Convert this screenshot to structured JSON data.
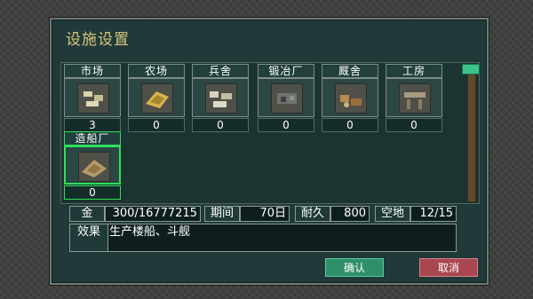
{
  "title": "设施设置",
  "facilities": [
    {
      "label": "市场",
      "count": "3",
      "icon": "market-icon",
      "color": "#cfc6a6"
    },
    {
      "label": "农场",
      "count": "0",
      "icon": "farm-icon",
      "color": "#d4b04a"
    },
    {
      "label": "兵舍",
      "count": "0",
      "icon": "barracks-icon",
      "color": "#c9c4b2"
    },
    {
      "label": "锻冶厂",
      "count": "0",
      "icon": "forge-icon",
      "color": "#6b6f6c"
    },
    {
      "label": "厩舍",
      "count": "0",
      "icon": "stable-icon",
      "color": "#b08552"
    },
    {
      "label": "工房",
      "count": "0",
      "icon": "workshop-icon",
      "color": "#a99b82"
    },
    {
      "label": "造船厂",
      "count": "0",
      "icon": "shipyard-icon",
      "color": "#b59a6a",
      "selected": true
    }
  ],
  "info": {
    "gold_label": "金",
    "gold_value": "300/16777215",
    "period_label": "期间",
    "period_value": "70日",
    "durability_label": "耐久",
    "durability_value": "800",
    "space_label": "空地",
    "space_value": "12/15"
  },
  "effect": {
    "label": "效果",
    "text": "生产楼船、斗舰"
  },
  "buttons": {
    "ok": "确认",
    "cancel": "取消"
  }
}
